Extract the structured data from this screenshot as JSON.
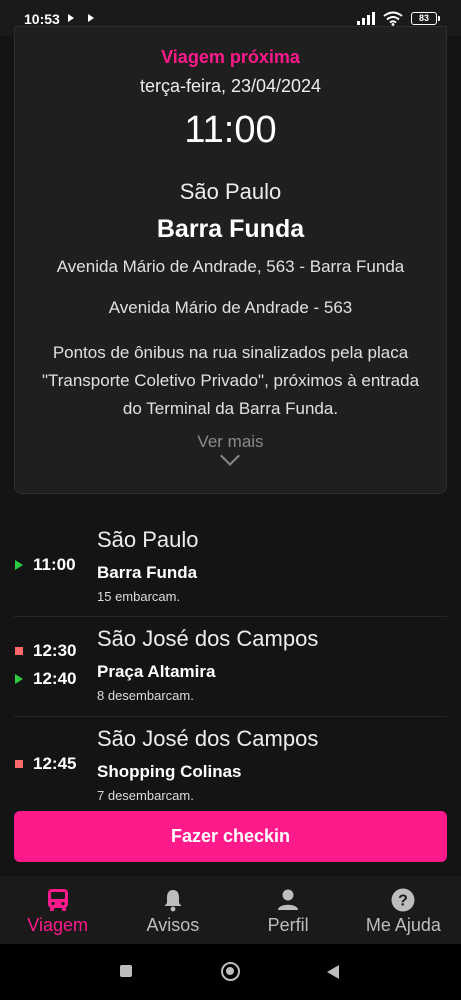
{
  "status_bar": {
    "time": "10:53",
    "battery": "83"
  },
  "trip": {
    "label": "Viagem próxima",
    "date": "terça-feira, 23/04/2024",
    "time": "11:00",
    "city": "São Paulo",
    "stop_name": "Barra Funda",
    "address": "Avenida Mário de Andrade, 563 - Barra Funda",
    "address_short": "Avenida Mário de Andrade - 563",
    "description": "Pontos de ônibus na rua sinalizados pela placa \"Transporte Coletivo Privado\", próximos à entrada do Terminal da Barra Funda.",
    "see_more": "Ver mais"
  },
  "itinerary": [
    {
      "city": "São Paulo",
      "stop": "Barra Funda",
      "note": "15 embarcam.",
      "times": [
        {
          "type": "board",
          "time": "11:00"
        }
      ]
    },
    {
      "city": "São José dos Campos",
      "stop": "Praça Altamira",
      "note": "8 desembarcam.",
      "times": [
        {
          "type": "alight",
          "time": "12:30"
        },
        {
          "type": "board",
          "time": "12:40"
        }
      ]
    },
    {
      "city": "São José dos Campos",
      "stop": "Shopping Colinas",
      "note": "7 desembarcam.",
      "times": [
        {
          "type": "alight",
          "time": "12:45"
        }
      ]
    }
  ],
  "checkin_label": "Fazer checkin",
  "nav": {
    "items": [
      {
        "label": "Viagem",
        "icon": "bus-icon",
        "active": true
      },
      {
        "label": "Avisos",
        "icon": "bell-icon",
        "active": false
      },
      {
        "label": "Perfil",
        "icon": "person-icon",
        "active": false
      },
      {
        "label": "Me Ajuda",
        "icon": "help-icon",
        "active": false
      }
    ]
  },
  "colors": {
    "accent": "#ff1a8c",
    "board_marker": "#2ecc40",
    "alight_marker": "#ff6b6b",
    "background": "#141414",
    "card": "#1f1f1f"
  }
}
